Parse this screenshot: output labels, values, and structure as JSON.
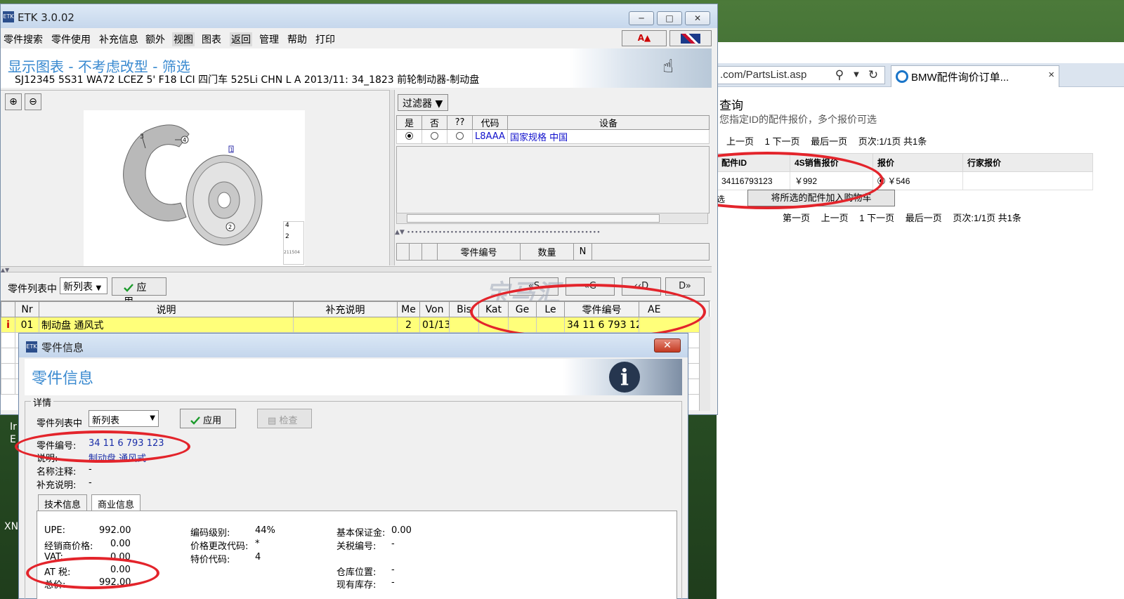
{
  "browser": {
    "address": ".com/PartsList.asp",
    "tab_title": "BMW配件询价订单...",
    "tab_close": "×",
    "page_title": "查询",
    "page_desc": "您指定ID的配件报价，多个报价可选",
    "pager_top": [
      "上一页",
      "1 下一页",
      "最后一页",
      "页次:1/1页 共1条"
    ],
    "pager_bottom": [
      "第一页",
      "上一页",
      "1 下一页",
      "最后一页",
      "页次:1/1页 共1条"
    ],
    "table": {
      "headers": [
        "配件ID",
        "4S销售报价",
        "报价",
        "行家报价"
      ],
      "row": [
        "34116793123",
        "￥992",
        "￥546",
        ""
      ]
    },
    "select_label": "选",
    "cart_button": "将所选的配件加入购物车"
  },
  "etk": {
    "title": "ETK 3.0.02",
    "menu": [
      "零件搜索",
      "零件使用",
      "补充信息",
      "额外",
      "视图",
      "图表",
      "返回",
      "管理",
      "帮助",
      "打印"
    ],
    "banner_title": "显示图表 - 不考虑改型 - 筛选",
    "banner_sub": "SJ12345 5S31 WA72 LCEZ 5' F18 LCI 四门车 525Li CHN L A 2013/11: 34_1823 前轮制动器-制动盘",
    "btn_a": "A",
    "diagram_labels": [
      "3",
      "4",
      "1",
      "2"
    ],
    "thumb_labels": [
      "4",
      "2",
      "211504"
    ],
    "filter": {
      "button": "过滤器",
      "headers": [
        "是",
        "否",
        "??",
        "代码",
        "设备"
      ],
      "row": {
        "code": "L8AAA",
        "equipment": "国家规格 中国"
      }
    },
    "parts_mini_headers": [
      "零件编号",
      "数量",
      "N"
    ],
    "toolbar": {
      "label": "零件列表中",
      "select": "新列表",
      "apply": "应用",
      "nav": [
        "«S",
        "«G",
        "‹‹D",
        "D»"
      ],
      "watermark": "宝马汇"
    },
    "parts_headers": [
      "",
      "Nr",
      "说明",
      "补充说明",
      "Me",
      "Von",
      "Bis",
      "Kat",
      "Ge",
      "Le",
      "零件编号",
      "AE"
    ],
    "parts_row": {
      "info": "i",
      "nr": "01",
      "desc": "制动盘 通风式",
      "supp": "",
      "me": "2",
      "von": "01/13",
      "bis": "",
      "kat": "",
      "ge": "",
      "le": "",
      "part_no": "34 11 6 793 123",
      "ae": ""
    }
  },
  "dialog": {
    "title": "零件信息",
    "banner_title": "零件信息",
    "details_legend": "详情",
    "list_label": "零件列表中",
    "list_select": "新列表",
    "apply": "应用",
    "check": "检查",
    "fields": {
      "part_no_k": "零件编号:",
      "part_no_v": "34 11 6 793 123",
      "desc_k": "说明:",
      "desc_v": "制动盘 通风式",
      "name_note_k": "名称注释:",
      "name_note_v": "-",
      "supp_k": "补充说明:",
      "supp_v": "-"
    },
    "tabs": [
      "技术信息",
      "商业信息"
    ],
    "commercial": {
      "upe_k": "UPE:",
      "upe_v": "992.00",
      "dealer_k": "经销商价格:",
      "dealer_v": "0.00",
      "vat_k": "VAT:",
      "vat_v": "0.00",
      "at_k": "AT 税:",
      "at_v": "0.00",
      "total_k": "总价:",
      "total_v": "992.00",
      "code_level_k": "编码级别:",
      "code_level_v": "44%",
      "price_change_k": "价格更改代码:",
      "price_change_v": "*",
      "special_k": "特价代码:",
      "special_v": "4",
      "deposit_k": "基本保证金:",
      "deposit_v": "0.00",
      "tariff_k": "关税编号:",
      "tariff_v": "-",
      "warehouse_k": "仓库位置:",
      "warehouse_v": "-",
      "stock_k": "现有库存:",
      "stock_v": "-"
    }
  },
  "desktop": {
    "left_text_1": "Ir",
    "left_text_2": "E",
    "left_text_3": "XN"
  },
  "colors": {
    "accent_blue": "#3a8ad0",
    "highlight_row": "#ffff7a",
    "annotation_red": "#e3242b",
    "link_blue": "#1010cc"
  }
}
